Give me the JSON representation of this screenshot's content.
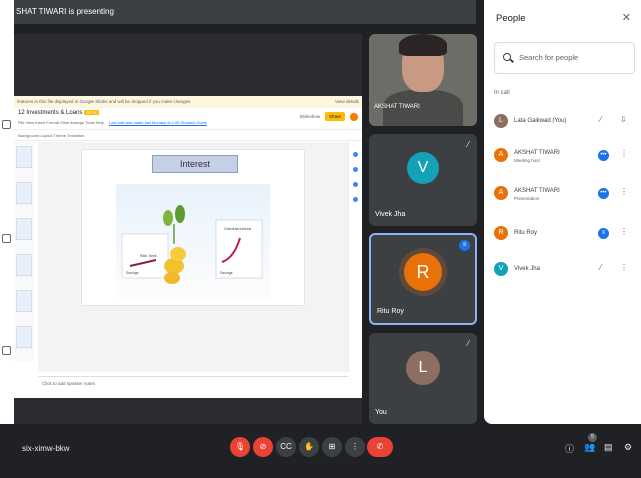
{
  "banner": {
    "text": "SHAT TIWARI is presenting"
  },
  "slides": {
    "notice": "features in this file displayed in Google Slides and will be dropped if you make changes",
    "notice_link": "View details",
    "doc_title": "12 Investments & Loans",
    "doc_badge": "PPTX",
    "menu": "File  View  Insert  Format  Slide  Arrange  Tools  Help",
    "menu_link": "Last edit was made last Monday at 1:05 Shadow Guide",
    "slideshow": "Slideshow",
    "share": "Share",
    "toolbar": "Background   Layout   Theme   Transition",
    "slide_title": "Interest",
    "label_principal": "Rabi Tamil",
    "label_interest": "Overdraft Interest",
    "label_s1": "Savings",
    "label_s2": "Savings",
    "speaker_notes": "Click to add speaker notes"
  },
  "tiles": {
    "cam_name": "AKSHAT TIWARI",
    "vivek": {
      "initial": "V",
      "name": "Vivek Jha",
      "color": "#12a3b8"
    },
    "ritu": {
      "initial": "R",
      "name": "Ritu Roy",
      "color": "#e8710a"
    },
    "you": {
      "initial": "L",
      "name": "You",
      "color": "#8d6e63"
    }
  },
  "people": {
    "title": "People",
    "search_placeholder": "Search for people",
    "section": "In call",
    "rows": [
      {
        "initial": "L",
        "name": "Lata Gaikwad (You)",
        "sub": "",
        "color": "#8d6e63",
        "state": "muted"
      },
      {
        "initial": "A",
        "name": "AKSHAT TIWARI",
        "sub": "Meeting host",
        "color": "#e8710a",
        "state": "active"
      },
      {
        "initial": "A",
        "name": "AKSHAT TIWARI",
        "sub": "Presentation",
        "color": "#e8710a",
        "state": "active"
      },
      {
        "initial": "R",
        "name": "Ritu Roy",
        "sub": "",
        "color": "#e8710a",
        "state": "speaking"
      },
      {
        "initial": "V",
        "name": "Vivek Jha",
        "sub": "",
        "color": "#12a3b8",
        "state": "muted"
      }
    ]
  },
  "bottom": {
    "meeting_code": "six-ximw-bkw",
    "people_count": "5"
  }
}
